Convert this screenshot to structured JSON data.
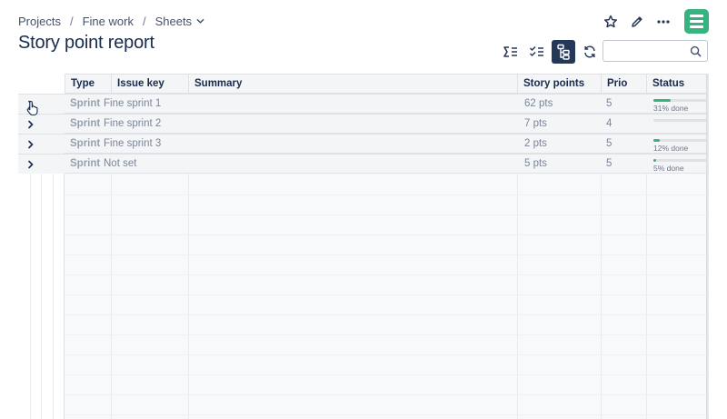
{
  "breadcrumb": {
    "items": [
      "Projects",
      "Fine work",
      "Sheets"
    ],
    "separator": "/"
  },
  "page": {
    "title": "Story point report"
  },
  "top_actions": [
    "star-icon",
    "edit-pencil-icon",
    "more-icon",
    "app-logo-icon"
  ],
  "toolbar": {
    "buttons": [
      "sigma-list-icon",
      "checklist-icon",
      "hierarchy-icon",
      "refresh-icon"
    ],
    "active": "hierarchy-icon"
  },
  "search": {
    "value": "",
    "placeholder": ""
  },
  "table": {
    "columns": [
      "Type",
      "Issue key",
      "Summary",
      "Story points",
      "Prio",
      "Status"
    ],
    "rows": [
      {
        "type": "Sprint",
        "name": "Fine sprint 1",
        "points": "62 pts",
        "prio": "5",
        "progress": 0.31,
        "status": "31% done"
      },
      {
        "type": "Sprint",
        "name": "Fine sprint 2",
        "points": "7 pts",
        "prio": "4",
        "progress": 0,
        "status": ""
      },
      {
        "type": "Sprint",
        "name": "Fine sprint 3",
        "points": "2 pts",
        "prio": "5",
        "progress": 0.12,
        "status": "12% done"
      },
      {
        "type": "Sprint",
        "name": "Not set",
        "points": "5 pts",
        "prio": "5",
        "progress": 0.05,
        "status": "5% done"
      }
    ]
  },
  "colors": {
    "accent": "#36b37e",
    "active_tool": "#253858",
    "text": "#172b4d",
    "muted": "#7a869a",
    "header_bg": "#f4f5f7",
    "grid_bg": "#f8f9fb"
  }
}
